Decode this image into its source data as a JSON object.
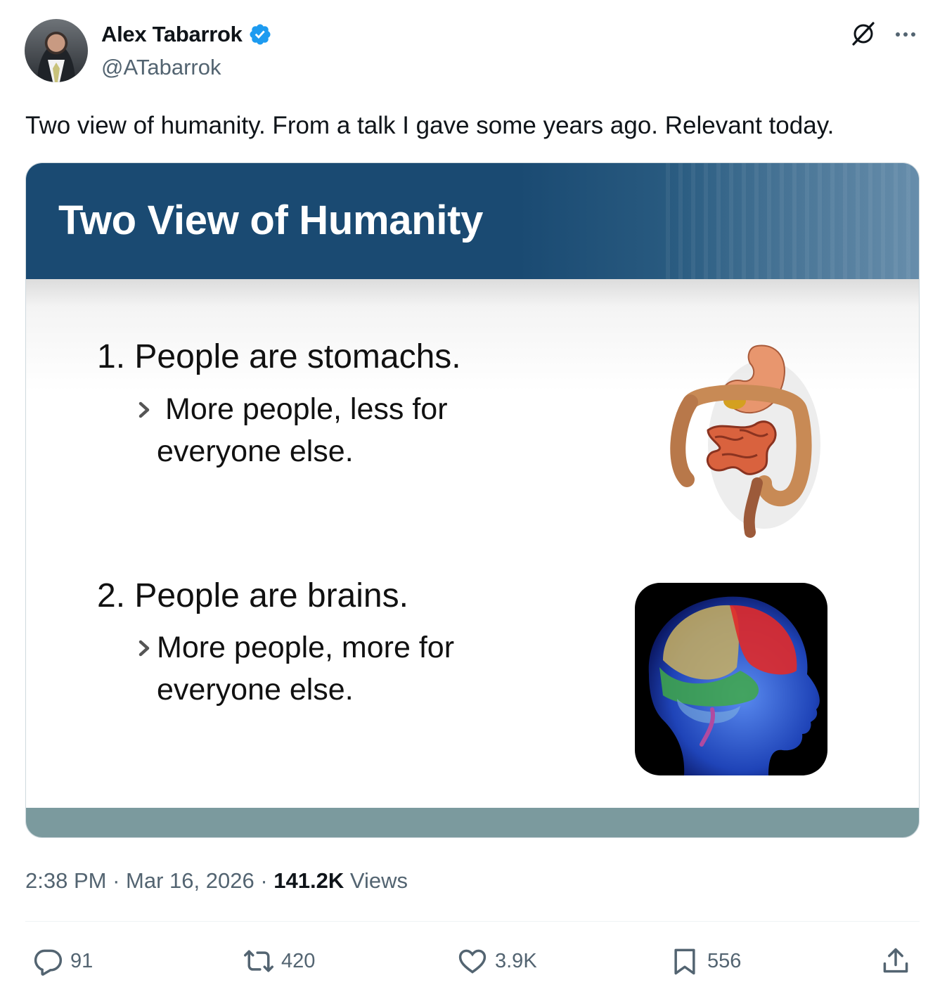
{
  "author": {
    "display_name": "Alex Tabarrok",
    "handle": "@ATabarrok",
    "verified_color": "#1d9bf0"
  },
  "tweet": {
    "text": "Two view of humanity. From a talk I gave some years ago. Relevant today."
  },
  "slide": {
    "title": "Two View of Humanity",
    "point1": "1. People are stomachs.",
    "point1_sub_line1": "More people, less for",
    "point1_sub_line2": "everyone else.",
    "point2": "2. People are brains.",
    "point2_sub_line1": "More people, more for",
    "point2_sub_line2": "everyone else.",
    "header_color": "#1a4a72",
    "footer_color": "#7b9a9e"
  },
  "meta": {
    "time": "2:38 PM",
    "date": "Mar 16, 2026",
    "views_count": "141.2K",
    "views_label": "Views",
    "separator": "·"
  },
  "actions": {
    "replies": "91",
    "reposts": "420",
    "likes": "3.9K",
    "bookmarks": "556"
  },
  "icons": [
    "verified-badge-icon",
    "grok-icon",
    "more-icon",
    "reply-icon",
    "repost-icon",
    "like-icon",
    "bookmark-icon",
    "share-icon"
  ]
}
